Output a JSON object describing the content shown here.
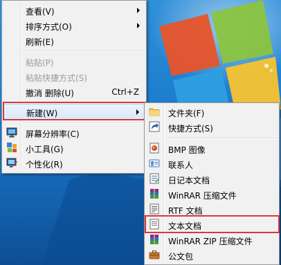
{
  "main_menu": {
    "items": [
      {
        "label": "查看(V)",
        "submenu": true
      },
      {
        "label": "排序方式(O)",
        "submenu": true
      },
      {
        "label": "刷新(E)"
      },
      {
        "label": "粘贴(P)",
        "disabled": true
      },
      {
        "label": "粘贴快捷方式(S)",
        "disabled": true
      },
      {
        "label": "撤消 删除(U)",
        "shortcut": "Ctrl+Z"
      },
      {
        "label": "新建(W)",
        "submenu": true,
        "selected": true
      },
      {
        "label": "屏幕分辨率(C)",
        "icon": "display-icon"
      },
      {
        "label": "小工具(G)",
        "icon": "gadgets-icon"
      },
      {
        "label": "个性化(R)",
        "icon": "personalize-icon"
      }
    ]
  },
  "new_submenu": {
    "items": [
      {
        "label": "文件夹(F)",
        "icon": "folder-icon"
      },
      {
        "label": "快捷方式(S)",
        "icon": "shortcut-icon"
      },
      {
        "label": "BMP 图像",
        "icon": "bmp-image-icon"
      },
      {
        "label": "联系人",
        "icon": "contact-icon"
      },
      {
        "label": "日记本文档",
        "icon": "journal-icon"
      },
      {
        "label": "WinRAR 压缩文件",
        "icon": "winrar-icon"
      },
      {
        "label": "RTF 文档",
        "icon": "rtf-document-icon"
      },
      {
        "label": "文本文档",
        "icon": "text-document-icon",
        "highlighted": true
      },
      {
        "label": "WinRAR ZIP 压缩文件",
        "icon": "winrar-zip-icon"
      },
      {
        "label": "公文包",
        "icon": "briefcase-icon"
      }
    ]
  },
  "colors": {
    "highlight_border": "#d9383a",
    "menu_bg": "#f1f1f1",
    "desktop_blue": "#1f7fcf"
  }
}
